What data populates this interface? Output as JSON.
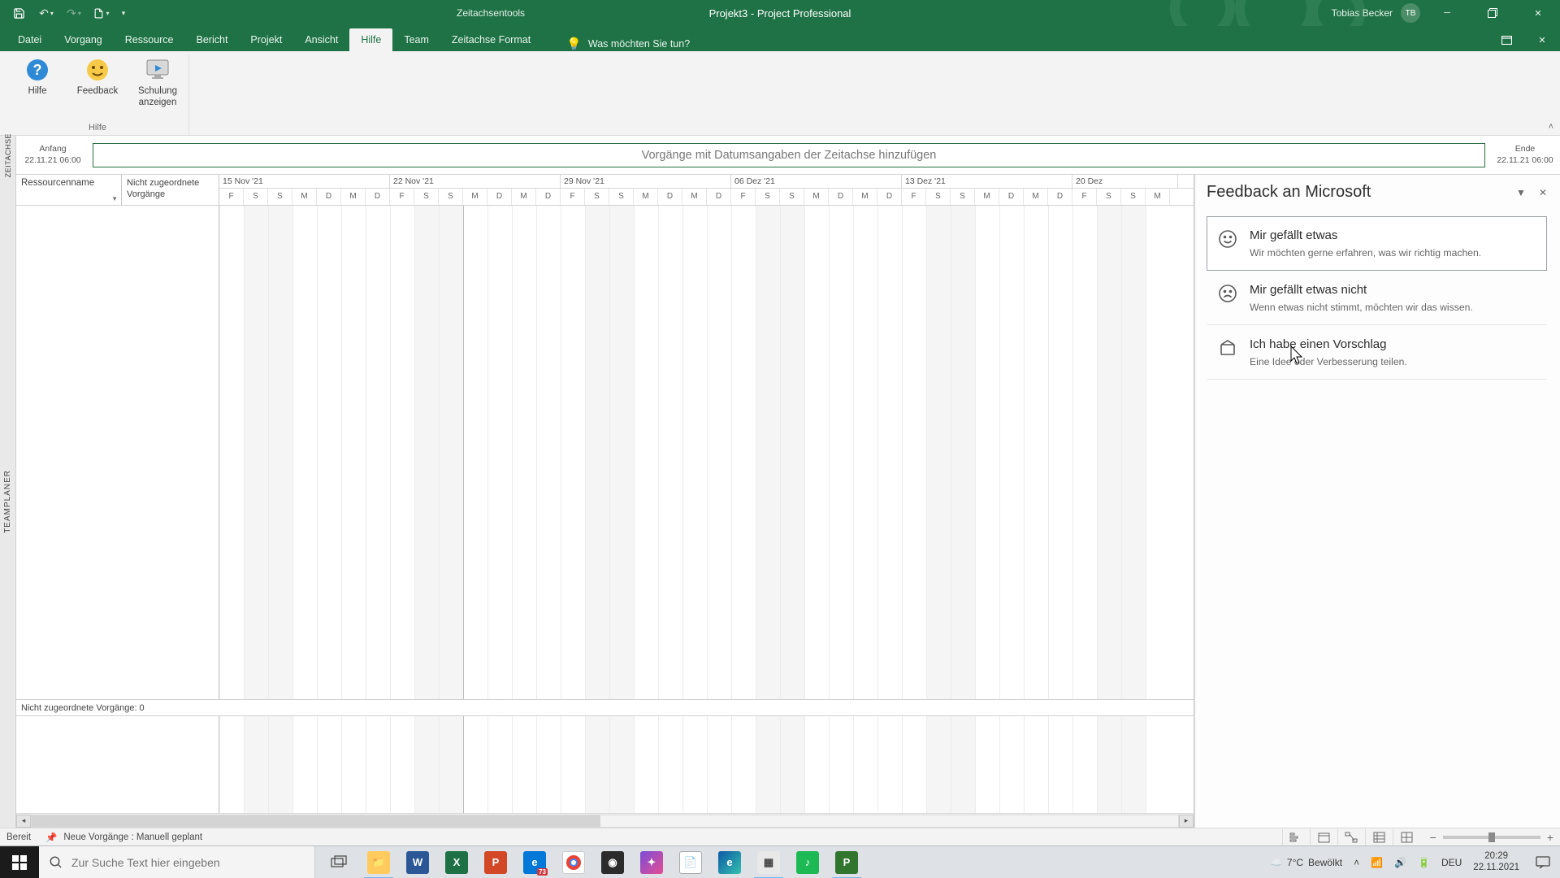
{
  "titlebar": {
    "tools_label": "Zeitachsentools",
    "doc_title": "Projekt3  -  Project Professional",
    "user_name": "Tobias Becker",
    "user_initials": "TB"
  },
  "tabs": {
    "items": [
      "Datei",
      "Vorgang",
      "Ressource",
      "Bericht",
      "Projekt",
      "Ansicht",
      "Hilfe",
      "Team",
      "Zeitachse Format"
    ],
    "active_index": 6,
    "tell_me": "Was möchten Sie tun?"
  },
  "ribbon": {
    "buttons": [
      {
        "label": "Hilfe"
      },
      {
        "label": "Feedback"
      },
      {
        "label": "Schulung\nanzeigen"
      }
    ],
    "group_name": "Hilfe"
  },
  "timeline": {
    "vtab": "ZEITACHSE",
    "start_label": "Anfang",
    "start_date": "22.11.21 06:00",
    "end_label": "Ende",
    "end_date": "22.11.21 06:00",
    "placeholder": "Vorgänge mit Datumsangaben der Zeitachse hinzufügen"
  },
  "planner": {
    "vtab": "TEAMPLANER",
    "col1": "Ressourcenname",
    "col2": "Nicht zugeordnete\nVorgänge",
    "weeks": [
      "15 Nov '21",
      "22 Nov '21",
      "29 Nov '21",
      "06 Dez '21",
      "13 Dez '21",
      "20 Dez"
    ],
    "days": [
      "F",
      "S",
      "S",
      "M",
      "D",
      "M",
      "D",
      "F",
      "S",
      "S",
      "M",
      "D",
      "M",
      "D",
      "F",
      "S",
      "S",
      "M",
      "D",
      "M",
      "D",
      "F",
      "S",
      "S",
      "M",
      "D",
      "M",
      "D",
      "F",
      "S",
      "S",
      "M",
      "D",
      "M",
      "D",
      "F",
      "S",
      "S",
      "M"
    ],
    "footer": "Nicht zugeordnete Vorgänge: 0"
  },
  "feedback": {
    "title": "Feedback an Microsoft",
    "cards": [
      {
        "title": "Mir gefällt etwas",
        "desc": "Wir möchten gerne erfahren, was wir richtig machen."
      },
      {
        "title": "Mir gefällt etwas nicht",
        "desc": "Wenn etwas nicht stimmt, möchten wir das wissen."
      },
      {
        "title": "Ich habe einen Vorschlag",
        "desc": "Eine Idee oder Verbesserung teilen."
      }
    ]
  },
  "statusbar": {
    "ready": "Bereit",
    "new_tasks": "Neue Vorgänge : Manuell geplant"
  },
  "taskbar": {
    "search_placeholder": "Zur Suche Text hier eingeben",
    "weather_temp": "7°C",
    "weather_text": "Bewölkt",
    "lang": "DEU",
    "time": "20:29",
    "date": "22.11.2021"
  }
}
